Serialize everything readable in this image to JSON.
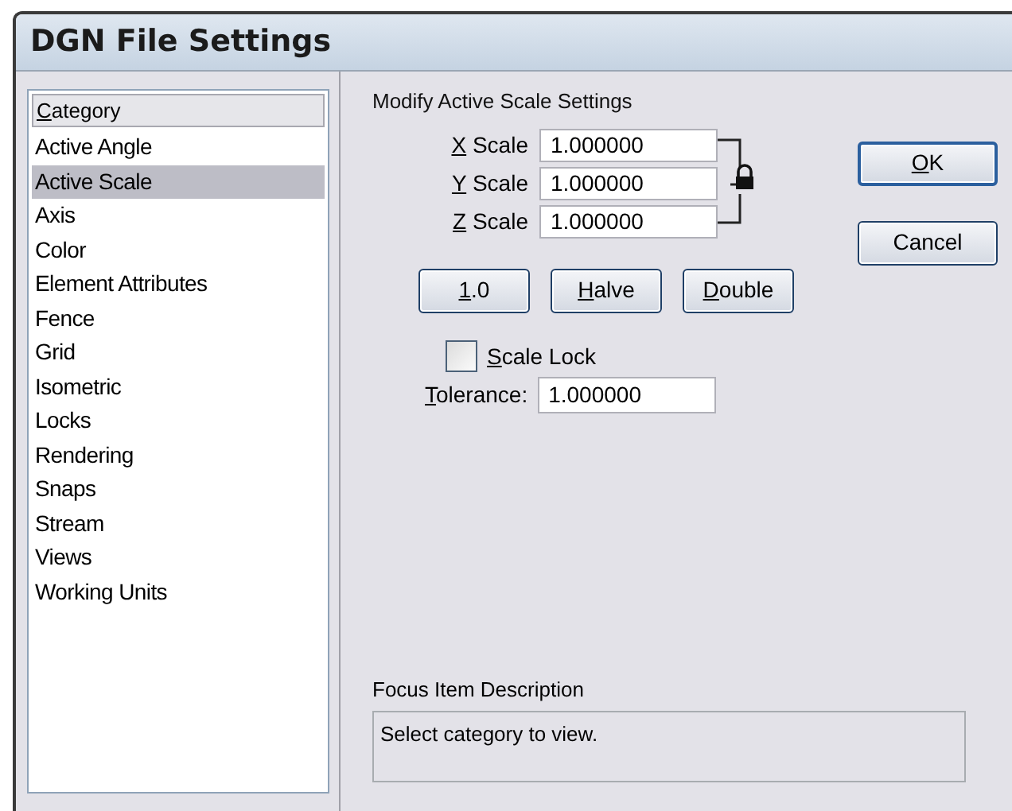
{
  "window": {
    "title": "DGN File Settings"
  },
  "category_list": {
    "header": {
      "label": "Category",
      "underline_first": true
    },
    "items": [
      {
        "label": "Active Angle",
        "selected": false
      },
      {
        "label": "Active Scale",
        "selected": true
      },
      {
        "label": "Axis",
        "selected": false
      },
      {
        "label": "Color",
        "selected": false
      },
      {
        "label": "Element Attributes",
        "selected": false
      },
      {
        "label": "Fence",
        "selected": false
      },
      {
        "label": "Grid",
        "selected": false
      },
      {
        "label": "Isometric",
        "selected": false
      },
      {
        "label": "Locks",
        "selected": false
      },
      {
        "label": "Rendering",
        "selected": false
      },
      {
        "label": "Snaps",
        "selected": false
      },
      {
        "label": "Stream",
        "selected": false
      },
      {
        "label": "Views",
        "selected": false
      },
      {
        "label": "Working Units",
        "selected": false
      }
    ]
  },
  "section_title": "Modify Active Scale Settings",
  "scale_fields": [
    {
      "label": "X Scale",
      "underline_first": true,
      "value": "1.000000"
    },
    {
      "label": "Y Scale",
      "underline_first": true,
      "value": "1.000000"
    },
    {
      "label": "Z Scale",
      "underline_first": true,
      "value": "1.000000"
    }
  ],
  "scale_buttons": [
    {
      "label": "1.0",
      "underline_first": true
    },
    {
      "label": "Halve",
      "underline_first": true
    },
    {
      "label": "Double",
      "underline_first": true
    }
  ],
  "scale_lock": {
    "label": "Scale Lock",
    "underline_first": true,
    "checked": false
  },
  "tolerance": {
    "label": "Tolerance:",
    "underline_first": true,
    "value": "1.000000"
  },
  "dialog_buttons": [
    {
      "label": "OK",
      "underline_first": true,
      "default": true
    },
    {
      "label": "Cancel",
      "underline_first": false,
      "default": false
    }
  ],
  "focus_description": {
    "label": "Focus Item Description",
    "text": "Select category to view."
  }
}
